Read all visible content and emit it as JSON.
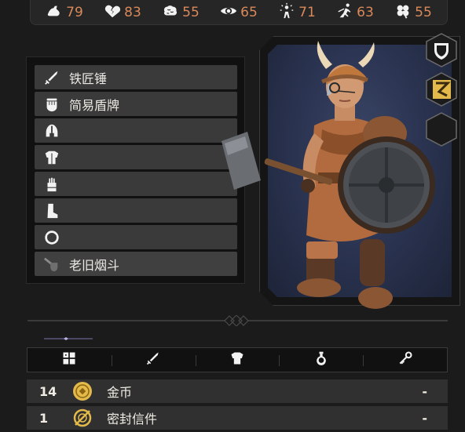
{
  "stats": [
    {
      "name": "strength",
      "icon": "flexed-arm-icon",
      "value": "79"
    },
    {
      "name": "health",
      "icon": "broken-heart-icon",
      "value": "83"
    },
    {
      "name": "intelligence",
      "icon": "brain-icon",
      "value": "55"
    },
    {
      "name": "perception",
      "icon": "eye-icon",
      "value": "65"
    },
    {
      "name": "willpower",
      "icon": "figure-burst-icon",
      "value": "71"
    },
    {
      "name": "agility",
      "icon": "running-figure-icon",
      "value": "63"
    },
    {
      "name": "luck",
      "icon": "clover-icon",
      "value": "55"
    }
  ],
  "equipment": [
    {
      "slot": "weapon",
      "icon": "sword-icon",
      "label": "铁匠锤"
    },
    {
      "slot": "offhand",
      "icon": "fist-icon",
      "label": "简易盾牌"
    },
    {
      "slot": "head",
      "icon": "helmet-icon",
      "label": ""
    },
    {
      "slot": "body",
      "icon": "armor-icon",
      "label": ""
    },
    {
      "slot": "hands",
      "icon": "gauntlet-icon",
      "label": ""
    },
    {
      "slot": "feet",
      "icon": "boot-icon",
      "label": ""
    },
    {
      "slot": "ring",
      "icon": "ring-icon",
      "label": ""
    },
    {
      "slot": "trinket",
      "icon": "pipe-icon",
      "label": "老旧烟斗"
    }
  ],
  "badges": [
    {
      "name": "shield-badge-icon"
    },
    {
      "name": "rune-badge-icon"
    },
    {
      "name": "empty-hex-badge"
    }
  ],
  "tabs": [
    {
      "name": "tab-all",
      "icon": "grid-icon"
    },
    {
      "name": "tab-weapons",
      "icon": "sword-icon"
    },
    {
      "name": "tab-armor",
      "icon": "armor-icon"
    },
    {
      "name": "tab-potions",
      "icon": "potion-icon"
    },
    {
      "name": "tab-misc",
      "icon": "key-icon"
    }
  ],
  "inventory": [
    {
      "qty": "14",
      "icon": "coin-icon",
      "name": "金币",
      "action": "-"
    },
    {
      "qty": "1",
      "icon": "sealed-letter-icon",
      "name": "密封信件",
      "action": "-"
    }
  ],
  "colors": {
    "accent": "#d9895a",
    "gold": "#e2b94a",
    "slot_bg": "#3a3a3b"
  }
}
